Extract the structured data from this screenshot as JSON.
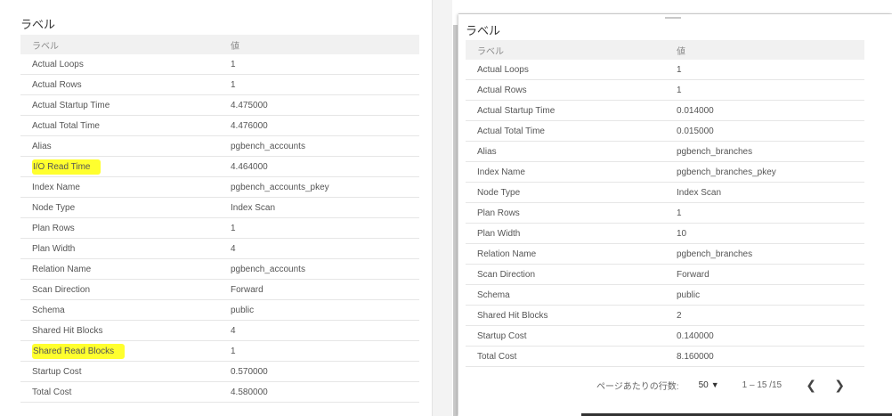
{
  "left": {
    "title": "ラベル",
    "columns": [
      "ラベル",
      "値"
    ],
    "rows": [
      [
        "Actual Loops",
        "1"
      ],
      [
        "Actual Rows",
        "1"
      ],
      [
        "Actual Startup Time",
        "4.475000"
      ],
      [
        "Actual Total Time",
        "4.476000"
      ],
      [
        "Alias",
        "pgbench_accounts"
      ],
      [
        "I/O Read Time",
        "4.464000"
      ],
      [
        "Index Name",
        "pgbench_accounts_pkey"
      ],
      [
        "Node Type",
        "Index Scan"
      ],
      [
        "Plan Rows",
        "1"
      ],
      [
        "Plan Width",
        "4"
      ],
      [
        "Relation Name",
        "pgbench_accounts"
      ],
      [
        "Scan Direction",
        "Forward"
      ],
      [
        "Schema",
        "public"
      ],
      [
        "Shared Hit Blocks",
        "4"
      ],
      [
        "Shared Read Blocks",
        "1"
      ],
      [
        "Startup Cost",
        "0.570000"
      ],
      [
        "Total Cost",
        "4.580000"
      ]
    ],
    "highlight_color": "#ffff2e"
  },
  "right": {
    "title": "ラベル",
    "columns": [
      "ラベル",
      "値"
    ],
    "rows": [
      [
        "Actual Loops",
        "1"
      ],
      [
        "Actual Rows",
        "1"
      ],
      [
        "Actual Startup Time",
        "0.014000"
      ],
      [
        "Actual Total Time",
        "0.015000"
      ],
      [
        "Alias",
        "pgbench_branches"
      ],
      [
        "Index Name",
        "pgbench_branches_pkey"
      ],
      [
        "Node Type",
        "Index Scan"
      ],
      [
        "Plan Rows",
        "1"
      ],
      [
        "Plan Width",
        "10"
      ],
      [
        "Relation Name",
        "pgbench_branches"
      ],
      [
        "Scan Direction",
        "Forward"
      ],
      [
        "Schema",
        "public"
      ],
      [
        "Shared Hit Blocks",
        "2"
      ],
      [
        "Startup Cost",
        "0.140000"
      ],
      [
        "Total Cost",
        "8.160000"
      ]
    ],
    "paginator": {
      "per_page_label": "ページあたりの行数:",
      "per_page_value": "50",
      "range": "1 – 15 /15",
      "prev_icon": "chevron-left-icon",
      "next_icon": "chevron-right-icon"
    }
  }
}
